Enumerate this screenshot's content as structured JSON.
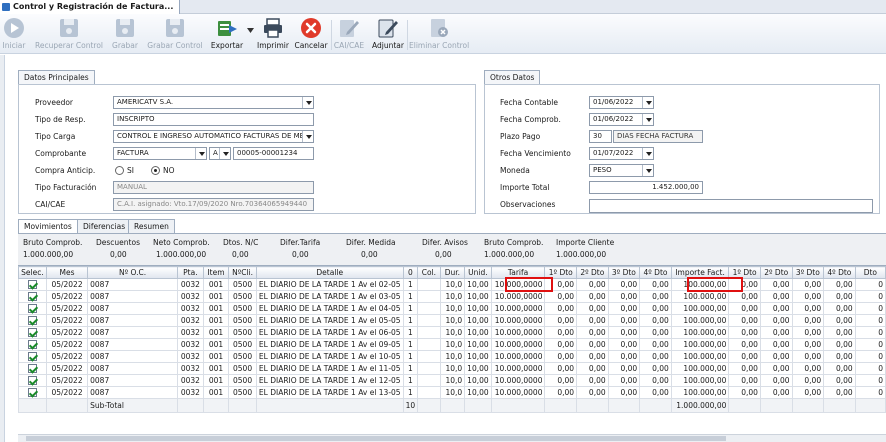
{
  "window": {
    "title": "Control y Registración de Factura..."
  },
  "toolbar": {
    "buttons": [
      {
        "label": "Iniciar",
        "icon": "play-icon",
        "enabled": false
      },
      {
        "label": "Recuperar Control",
        "icon": "disk-icon",
        "enabled": false
      },
      {
        "label": "Grabar",
        "icon": "disk-icon",
        "enabled": false
      },
      {
        "label": "Grabar Control",
        "icon": "disk-icon",
        "enabled": false
      },
      {
        "label": "Exportar",
        "icon": "export-icon",
        "enabled": true
      },
      {
        "label": "Imprimir",
        "icon": "printer-icon",
        "enabled": true
      },
      {
        "label": "Cancelar",
        "icon": "cancel-icon",
        "enabled": true
      },
      {
        "label": "CAI/CAE",
        "icon": "edit-icon",
        "enabled": false
      },
      {
        "label": "Adjuntar",
        "icon": "attach-icon",
        "enabled": true
      },
      {
        "label": "Eliminar Control",
        "icon": "delete-icon",
        "enabled": false
      }
    ]
  },
  "datos_principales": {
    "tab": "Datos Principales",
    "proveedor": {
      "label": "Proveedor",
      "value": "AMERICATV S.A."
    },
    "tipo_resp": {
      "label": "Tipo de Resp.",
      "value": "INSCRIPTO"
    },
    "tipo_carga": {
      "label": "Tipo Carga",
      "value": "CONTROL E INGRESO AUTOMATICO FACTURAS DE MED"
    },
    "comprobante": {
      "label": "Comprobante",
      "tipo": "FACTURA",
      "letra": "A",
      "numero": "00005-00001234"
    },
    "compra_anticip": {
      "label": "Compra Anticip.",
      "si": "SI",
      "no": "NO"
    },
    "tipo_facturacion": {
      "label": "Tipo Facturación",
      "value": "MANUAL"
    },
    "cai_cae": {
      "label": "CAI/CAE",
      "value": "C.A.I. asignado: Vto.17/09/2020 Nro.70364065949440"
    }
  },
  "otros_datos": {
    "tab": "Otros Datos",
    "fecha_contable": {
      "label": "Fecha Contable",
      "value": "01/06/2022"
    },
    "fecha_comprob": {
      "label": "Fecha Comprob.",
      "value": "01/06/2022"
    },
    "plazo_pago": {
      "label": "Plazo Pago",
      "dias": "30",
      "desc": "DIAS FECHA FACTURA"
    },
    "fecha_vencimiento": {
      "label": "Fecha Vencimiento",
      "value": "01/07/2022"
    },
    "moneda": {
      "label": "Moneda",
      "value": "PESO"
    },
    "importe_total": {
      "label": "Importe Total",
      "value": "1.452.000,00"
    },
    "observaciones": {
      "label": "Observaciones",
      "value": ""
    }
  },
  "subtabs": [
    "Movimientos",
    "Diferencias",
    "Resumen"
  ],
  "summary": [
    {
      "label": "Bruto Comprob.",
      "value": "1.000.000,00"
    },
    {
      "label": "Descuentos",
      "value": "0,00"
    },
    {
      "label": "Neto Comprob.",
      "value": "1.000.000,00"
    },
    {
      "label": "Dtos. N/C",
      "value": "0,00"
    },
    {
      "label": "Difer.Tarifa",
      "value": "0,00"
    },
    {
      "label": "Difer. Medida",
      "value": "0,00"
    },
    {
      "label": "Difer. Avisos",
      "value": "0,00"
    },
    {
      "label": "Bruto Comprob.",
      "value": "1.000.000,00"
    },
    {
      "label": "Importe Cliente",
      "value": "1.000.000,00"
    }
  ],
  "grid": {
    "columns": [
      "Selec.",
      "Mes",
      "Nº O.C.",
      "Pta.",
      "Item",
      "NºCli.",
      "Detalle",
      "0",
      "Col.",
      "Dur.",
      "Unid.",
      "Tarifa",
      "1º Dto",
      "2º Dto",
      "3º Dto",
      "4º Dto",
      "Importe Fact.",
      "1º Dto",
      "2º Dto",
      "3º Dto",
      "4º Dto",
      "Dto"
    ],
    "rows": [
      {
        "sel": true,
        "mes": "05/2022",
        "oc": "0087",
        "pta": "0032",
        "item": "001",
        "cli": "0500",
        "detalle": "EL DIARIO DE LA TARDE 1 Av el 02-05",
        "z": "1",
        "col": "",
        "dur": "10,0",
        "unid": "10,00",
        "tarifa": "10.000,0000",
        "d1": "0,00",
        "d2": "0,00",
        "d3": "0,00",
        "d4": "0,00",
        "importe": "100.000,00",
        "e1": "0,00",
        "e2": "0,00",
        "e3": "0,00",
        "e4": "0,00",
        "e5": "0"
      },
      {
        "sel": true,
        "mes": "05/2022",
        "oc": "0087",
        "pta": "0032",
        "item": "001",
        "cli": "0500",
        "detalle": "EL DIARIO DE LA TARDE 1 Av el 03-05",
        "z": "1",
        "col": "",
        "dur": "10,0",
        "unid": "10,00",
        "tarifa": "10.000,0000",
        "d1": "0,00",
        "d2": "0,00",
        "d3": "0,00",
        "d4": "0,00",
        "importe": "100.000,00",
        "e1": "0,00",
        "e2": "0,00",
        "e3": "0,00",
        "e4": "0,00",
        "e5": "0"
      },
      {
        "sel": true,
        "mes": "05/2022",
        "oc": "0087",
        "pta": "0032",
        "item": "001",
        "cli": "0500",
        "detalle": "EL DIARIO DE LA TARDE 1 Av el 04-05",
        "z": "1",
        "col": "",
        "dur": "10,0",
        "unid": "10,00",
        "tarifa": "10.000,0000",
        "d1": "0,00",
        "d2": "0,00",
        "d3": "0,00",
        "d4": "0,00",
        "importe": "100.000,00",
        "e1": "0,00",
        "e2": "0,00",
        "e3": "0,00",
        "e4": "0,00",
        "e5": "0"
      },
      {
        "sel": true,
        "mes": "05/2022",
        "oc": "0087",
        "pta": "0032",
        "item": "001",
        "cli": "0500",
        "detalle": "EL DIARIO DE LA TARDE 1 Av el 05-05",
        "z": "1",
        "col": "",
        "dur": "10,0",
        "unid": "10,00",
        "tarifa": "10.000,0000",
        "d1": "0,00",
        "d2": "0,00",
        "d3": "0,00",
        "d4": "0,00",
        "importe": "100.000,00",
        "e1": "0,00",
        "e2": "0,00",
        "e3": "0,00",
        "e4": "0,00",
        "e5": "0"
      },
      {
        "sel": true,
        "mes": "05/2022",
        "oc": "0087",
        "pta": "0032",
        "item": "001",
        "cli": "0500",
        "detalle": "EL DIARIO DE LA TARDE 1 Av el 06-05",
        "z": "1",
        "col": "",
        "dur": "10,0",
        "unid": "10,00",
        "tarifa": "10.000,0000",
        "d1": "0,00",
        "d2": "0,00",
        "d3": "0,00",
        "d4": "0,00",
        "importe": "100.000,00",
        "e1": "0,00",
        "e2": "0,00",
        "e3": "0,00",
        "e4": "0,00",
        "e5": "0"
      },
      {
        "sel": true,
        "mes": "05/2022",
        "oc": "0087",
        "pta": "0032",
        "item": "001",
        "cli": "0500",
        "detalle": "EL DIARIO DE LA TARDE 1 Av el 09-05",
        "z": "1",
        "col": "",
        "dur": "10,0",
        "unid": "10,00",
        "tarifa": "10.000,0000",
        "d1": "0,00",
        "d2": "0,00",
        "d3": "0,00",
        "d4": "0,00",
        "importe": "100.000,00",
        "e1": "0,00",
        "e2": "0,00",
        "e3": "0,00",
        "e4": "0,00",
        "e5": "0"
      },
      {
        "sel": true,
        "mes": "05/2022",
        "oc": "0087",
        "pta": "0032",
        "item": "001",
        "cli": "0500",
        "detalle": "EL DIARIO DE LA TARDE 1 Av el 10-05",
        "z": "1",
        "col": "",
        "dur": "10,0",
        "unid": "10,00",
        "tarifa": "10.000,0000",
        "d1": "0,00",
        "d2": "0,00",
        "d3": "0,00",
        "d4": "0,00",
        "importe": "100.000,00",
        "e1": "0,00",
        "e2": "0,00",
        "e3": "0,00",
        "e4": "0,00",
        "e5": "0"
      },
      {
        "sel": true,
        "mes": "05/2022",
        "oc": "0087",
        "pta": "0032",
        "item": "001",
        "cli": "0500",
        "detalle": "EL DIARIO DE LA TARDE 1 Av el 11-05",
        "z": "1",
        "col": "",
        "dur": "10,0",
        "unid": "10,00",
        "tarifa": "10.000,0000",
        "d1": "0,00",
        "d2": "0,00",
        "d3": "0,00",
        "d4": "0,00",
        "importe": "100.000,00",
        "e1": "0,00",
        "e2": "0,00",
        "e3": "0,00",
        "e4": "0,00",
        "e5": "0"
      },
      {
        "sel": true,
        "mes": "05/2022",
        "oc": "0087",
        "pta": "0032",
        "item": "001",
        "cli": "0500",
        "detalle": "EL DIARIO DE LA TARDE 1 Av el 12-05",
        "z": "1",
        "col": "",
        "dur": "10,0",
        "unid": "10,00",
        "tarifa": "10.000,0000",
        "d1": "0,00",
        "d2": "0,00",
        "d3": "0,00",
        "d4": "0,00",
        "importe": "100.000,00",
        "e1": "0,00",
        "e2": "0,00",
        "e3": "0,00",
        "e4": "0,00",
        "e5": "0"
      },
      {
        "sel": true,
        "mes": "05/2022",
        "oc": "0087",
        "pta": "0032",
        "item": "001",
        "cli": "0500",
        "detalle": "EL DIARIO DE LA TARDE 1 Av el 13-05",
        "z": "1",
        "col": "",
        "dur": "10,0",
        "unid": "10,00",
        "tarifa": "10.000,0000",
        "d1": "0,00",
        "d2": "0,00",
        "d3": "0,00",
        "d4": "0,00",
        "importe": "100.000,00",
        "e1": "0,00",
        "e2": "0,00",
        "e3": "0,00",
        "e4": "0,00",
        "e5": "0"
      }
    ],
    "subtotal": {
      "label": "Sub-Total",
      "z": "10",
      "importe": "1.000.000,00"
    }
  },
  "colors": {
    "highlight": "#e01010",
    "check": "#1a8a2a",
    "cancel": "#e03a2a",
    "accent": "#2f6fc0"
  }
}
